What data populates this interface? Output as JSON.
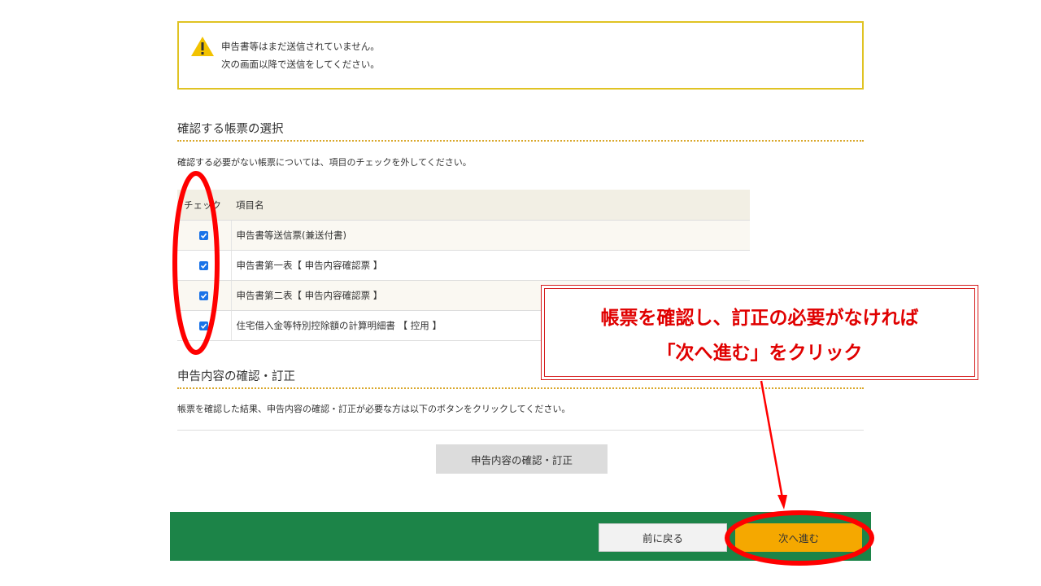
{
  "notice": {
    "line1": "申告書等はまだ送信されていません。",
    "line2": "次の画面以降で送信をしてください。"
  },
  "form_select": {
    "title": "確認する帳票の選択",
    "description": "確認する必要がない帳票については、項目のチェックを外してください。",
    "columns": [
      "チェック",
      "項目名"
    ],
    "rows": [
      {
        "label": "申告書等送信票(兼送付書)",
        "checked": true
      },
      {
        "label": "申告書第一表【 申告内容確認票 】",
        "checked": true
      },
      {
        "label": "申告書第二表【 申告内容確認票 】",
        "checked": true
      },
      {
        "label": "住宅借入金等特別控除額の計算明細書 【 控用 】",
        "checked": true
      }
    ]
  },
  "review": {
    "title": "申告内容の確認・訂正",
    "description": "帳票を確認した結果、申告内容の確認・訂正が必要な方は以下のボタンをクリックしてください。",
    "button_label": "申告内容の確認・訂正"
  },
  "footer": {
    "back_label": "前に戻る",
    "next_label": "次へ進む"
  },
  "annotation": {
    "line1": "帳票を確認し、訂正の必要がなければ",
    "line2": "「次へ進む」をクリック"
  },
  "colors": {
    "warning_border": "#e0c323",
    "footer_bg": "#1c8448",
    "next_button": "#f5a800",
    "annotation_red": "#e00000",
    "dotted_divider": "#d9a72a"
  }
}
